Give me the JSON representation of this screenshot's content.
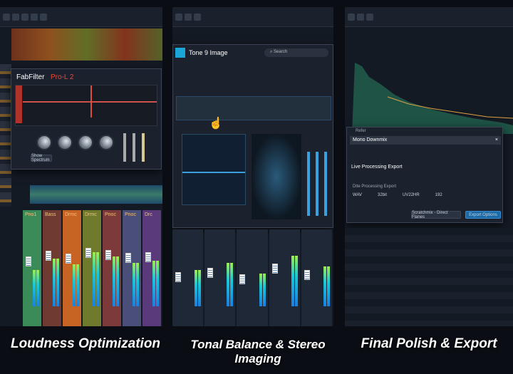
{
  "panels": [
    {
      "caption": "Loudness Optimization",
      "plugin": {
        "brand": "FabFilter",
        "name": "Pro-L 2",
        "button": "Show Spectrum"
      },
      "channels": [
        {
          "name": "Pno1",
          "color": "#3b8b58"
        },
        {
          "name": "Bass",
          "color": "#6e3a32"
        },
        {
          "name": "Drmc",
          "color": "#c76424"
        },
        {
          "name": "Drmc",
          "color": "#6f7a2c"
        },
        {
          "name": "Pnoc",
          "color": "#7c3a3a"
        },
        {
          "name": "Pnoc",
          "color": "#4a4f7a"
        },
        {
          "name": "Drc",
          "color": "#5a3a7a"
        }
      ],
      "meter_levels": [
        0.42,
        0.55,
        0.48,
        0.62,
        0.57,
        0.5,
        0.52
      ]
    },
    {
      "caption": "Tonal Balance & Stereo Imaging",
      "plugin": {
        "name": "Tone 9 Image",
        "search_placeholder": "Search"
      },
      "meter_levels": [
        0.5,
        0.6,
        0.45,
        0.7,
        0.55
      ]
    },
    {
      "caption": "Final Polish & Export",
      "dialog": {
        "title": "Mono Downmix",
        "window": "Refer",
        "row1": "Live Processing Export",
        "section": "Dite Processing Export",
        "options": [
          "WAV",
          "32bit",
          "UV22HR",
          "192"
        ],
        "cancel": "Scratchmix - Direct Flanes",
        "export": "Export Options"
      }
    }
  ],
  "colors": {
    "accent": "#1aa7d8",
    "background": "#0a0d14"
  }
}
